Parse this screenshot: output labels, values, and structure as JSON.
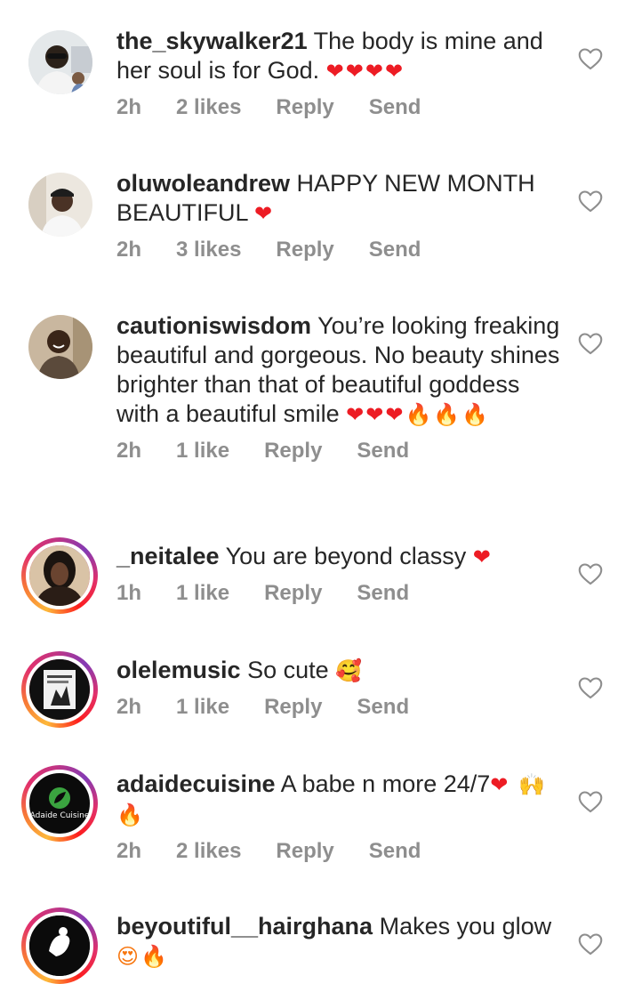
{
  "comments": [
    {
      "username": "the_skywalker21",
      "text": "The body is mine and her soul is for God.",
      "emoji": "❤❤❤❤",
      "time": "2h",
      "likes": "2 likes",
      "reply": "Reply",
      "send": "Send",
      "avatar_story_ring": false
    },
    {
      "username": "oluwoleandrew",
      "text": "HAPPY NEW MONTH BEAUTIFUL",
      "emoji": "❤",
      "time": "2h",
      "likes": "3 likes",
      "reply": "Reply",
      "send": "Send",
      "avatar_story_ring": false
    },
    {
      "username": "cautioniswisdom",
      "text": "You’re looking freaking beautiful and gorgeous. No beauty shines brighter than that of beautiful goddess with a beautiful smile",
      "emoji": "❤❤❤🔥🔥🔥",
      "time": "2h",
      "likes": "1 like",
      "reply": "Reply",
      "send": "Send",
      "avatar_story_ring": false
    },
    {
      "username": "_neitalee",
      "text": "You are beyond classy",
      "emoji": "❤",
      "time": "1h",
      "likes": "1 like",
      "reply": "Reply",
      "send": "Send",
      "avatar_story_ring": true
    },
    {
      "username": "olelemusic",
      "text": "So cute",
      "emoji": "🥰",
      "time": "2h",
      "likes": "1 like",
      "reply": "Reply",
      "send": "Send",
      "avatar_story_ring": true
    },
    {
      "username": "adaidecuisine",
      "text": "A babe n more 24/7",
      "emoji": "❤ 🙌🔥",
      "time": "2h",
      "likes": "2 likes",
      "reply": "Reply",
      "send": "Send",
      "avatar_story_ring": true,
      "avatar_logo_text": "Adaide Cuisine"
    },
    {
      "username": "beyoutiful__hairghana",
      "text": "Makes you glow",
      "emoji": "😍🔥",
      "time": "",
      "likes": "",
      "reply": "",
      "send": "",
      "avatar_story_ring": true
    }
  ],
  "colors": {
    "text": "#262626",
    "meta": "#8e8e8e",
    "heart_red": "#ed1c24"
  },
  "icons": {
    "like": "heart-outline-icon"
  }
}
